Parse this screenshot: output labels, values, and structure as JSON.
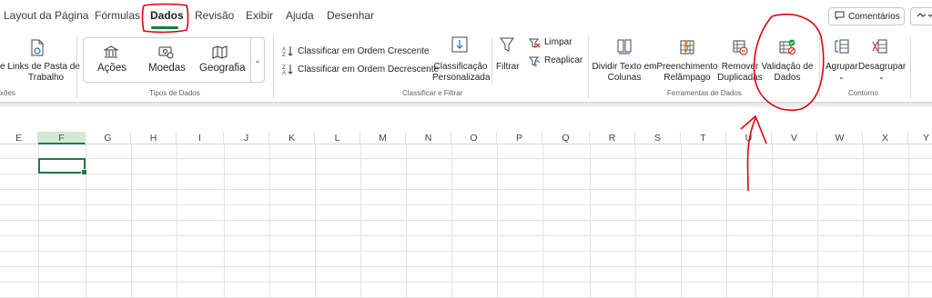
{
  "tabs": [
    {
      "label": "Layout da Página",
      "active": false
    },
    {
      "label": "Fórmulas",
      "active": false
    },
    {
      "label": "Dados",
      "active": true
    },
    {
      "label": "Revisão",
      "active": false
    },
    {
      "label": "Exibir",
      "active": false
    },
    {
      "label": "Ajuda",
      "active": false
    },
    {
      "label": "Desenhar",
      "active": false
    }
  ],
  "top_right": {
    "comments_label": "Comentários"
  },
  "ribbon": {
    "queries": {
      "links_line1": "e Links de Pasta de",
      "links_line2": "Trabalho",
      "group_label": "xões"
    },
    "data_types": {
      "items": [
        {
          "label": "Ações",
          "icon": "bank-icon"
        },
        {
          "label": "Moedas",
          "icon": "currency-icon"
        },
        {
          "label": "Geografia",
          "icon": "map-icon"
        }
      ],
      "group_label": "Tipos de Dados"
    },
    "sort_filter": {
      "sort_asc": "Classificar em Ordem Crescente",
      "sort_desc": "Classificar em Ordem Decrescente",
      "custom_sort_line1": "Classificação",
      "custom_sort_line2": "Personalizada",
      "filter": "Filtrar",
      "clear": "Limpar",
      "reapply": "Reaplicar",
      "group_label": "Classificar e Filtrar"
    },
    "data_tools": {
      "text_to_columns_line1": "Dividir Texto em",
      "text_to_columns_line2": "Colunas",
      "flash_fill_line1": "Preenchimento",
      "flash_fill_line2": "Relâmpago",
      "remove_dup_line1": "Remover",
      "remove_dup_line2": "Duplicadas",
      "validation_line1": "Validação de",
      "validation_line2": "Dados",
      "group_label": "Ferramentas de Dados"
    },
    "outline": {
      "group": "Agrupar",
      "ungroup": "Desagrupar",
      "group_label": "Contorno"
    }
  },
  "grid": {
    "columns": [
      "E",
      "F",
      "G",
      "H",
      "I",
      "J",
      "K",
      "L",
      "M",
      "N",
      "O",
      "P",
      "Q",
      "R",
      "S",
      "T",
      "U",
      "V",
      "W",
      "X",
      "Y"
    ],
    "active_column": "F"
  },
  "colors": {
    "accent": "#1f7a43",
    "annotation": "#e3000f"
  }
}
